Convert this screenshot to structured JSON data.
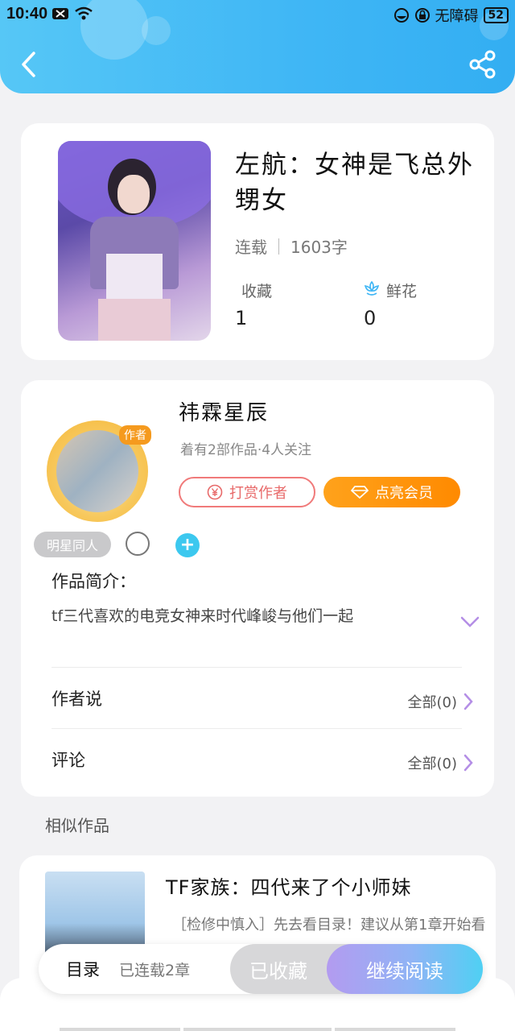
{
  "status": {
    "time": "10:40",
    "accessibility": "无障碍",
    "battery": "52"
  },
  "book": {
    "title": "左航：女神是飞总外甥女",
    "status": "连载",
    "word_count": "1603字",
    "collect_label": "收藏",
    "collect_value": "1",
    "flower_label": "鲜花",
    "flower_value": "0"
  },
  "author": {
    "tag": "作者",
    "name": "祎霖星辰",
    "meta": "着有2部作品·4人关注",
    "tip_label": "打赏作者",
    "vip_label": "点亮会员",
    "badge": "明星同人"
  },
  "intro": {
    "heading": "作品简介：",
    "text": "tf三代喜欢的电竞女神来时代峰峻与他们一起"
  },
  "rows": {
    "author_says": "作者说",
    "author_says_more": "全部(0)",
    "comments": "评论",
    "comments_more": "全部(0)"
  },
  "similar": {
    "heading": "相似作品",
    "title": "TF家族：四代来了个小师妹",
    "desc": "［检修中慎入］先去看目录！建议从第1章开始看"
  },
  "bottom": {
    "toc": "目录",
    "toc_sub": "已连载2章",
    "fav": "已收藏",
    "read": "继续阅读"
  },
  "colors": {
    "header": "#3fb6f5",
    "vip": "#ff8a00",
    "tip": "#f07a7a",
    "accent_purple": "#b48ee6"
  }
}
